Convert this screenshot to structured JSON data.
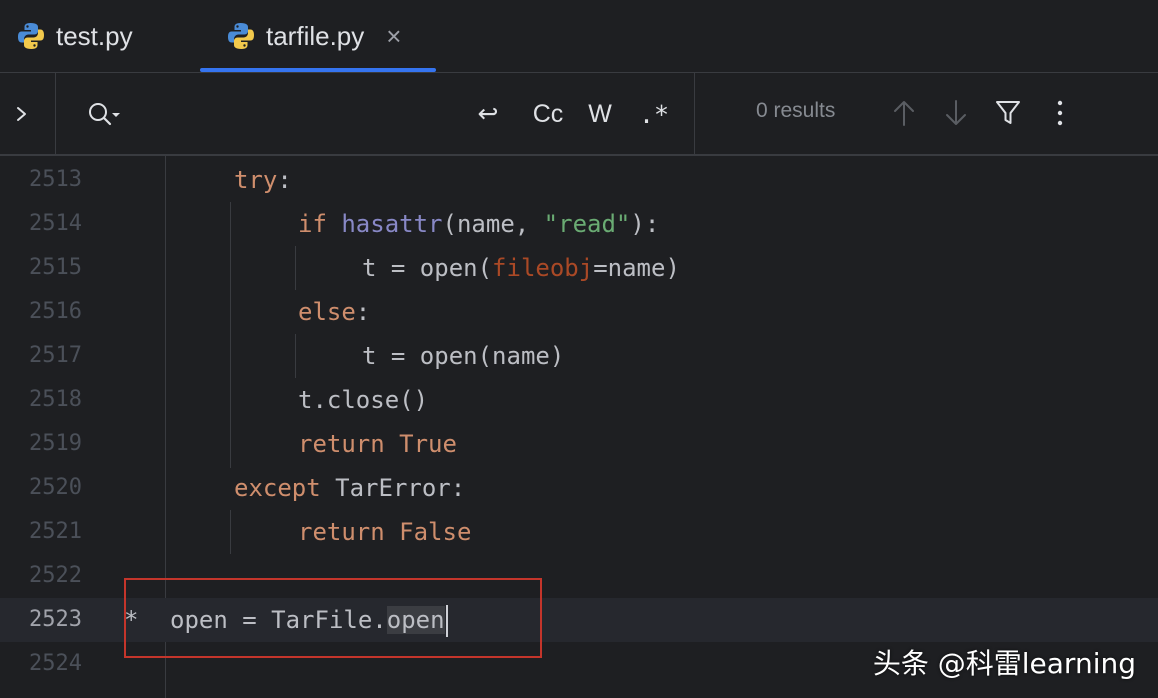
{
  "tabs": [
    {
      "label": "test.py",
      "icon": "python-file-icon",
      "active": false
    },
    {
      "label": "tarfile.py",
      "icon": "python-file-icon",
      "active": true,
      "close_glyph": "×"
    }
  ],
  "search": {
    "value": "",
    "options": {
      "wrap_glyph": "↩",
      "match_case": "Cc",
      "words": "W",
      "regex": ".*"
    },
    "results": "0 results"
  },
  "editor": {
    "current_line": 2523,
    "lines": [
      {
        "num": "2513",
        "code": "try:"
      },
      {
        "num": "2514",
        "code": "if hasattr(name, \"read\"):"
      },
      {
        "num": "2515",
        "code": "t = open(fileobj=name)"
      },
      {
        "num": "2516",
        "code": "else:"
      },
      {
        "num": "2517",
        "code": "t = open(name)"
      },
      {
        "num": "2518",
        "code": "t.close()"
      },
      {
        "num": "2519",
        "code": "return True"
      },
      {
        "num": "2520",
        "code": "except TarError:"
      },
      {
        "num": "2521",
        "code": "return False"
      },
      {
        "num": "2522",
        "code": ""
      },
      {
        "num": "2523",
        "code": "open = TarFile.open",
        "marker": "*"
      },
      {
        "num": "2524",
        "code": ""
      }
    ]
  },
  "watermark": "头条 @科雷learning",
  "colors": {
    "background": "#1e1f22",
    "accent": "#3574f0",
    "keyword": "#cf8e6d",
    "builtin": "#8888c6",
    "string": "#6aab73",
    "parameter": "#aa4926",
    "annotation_box": "#c4352b"
  }
}
